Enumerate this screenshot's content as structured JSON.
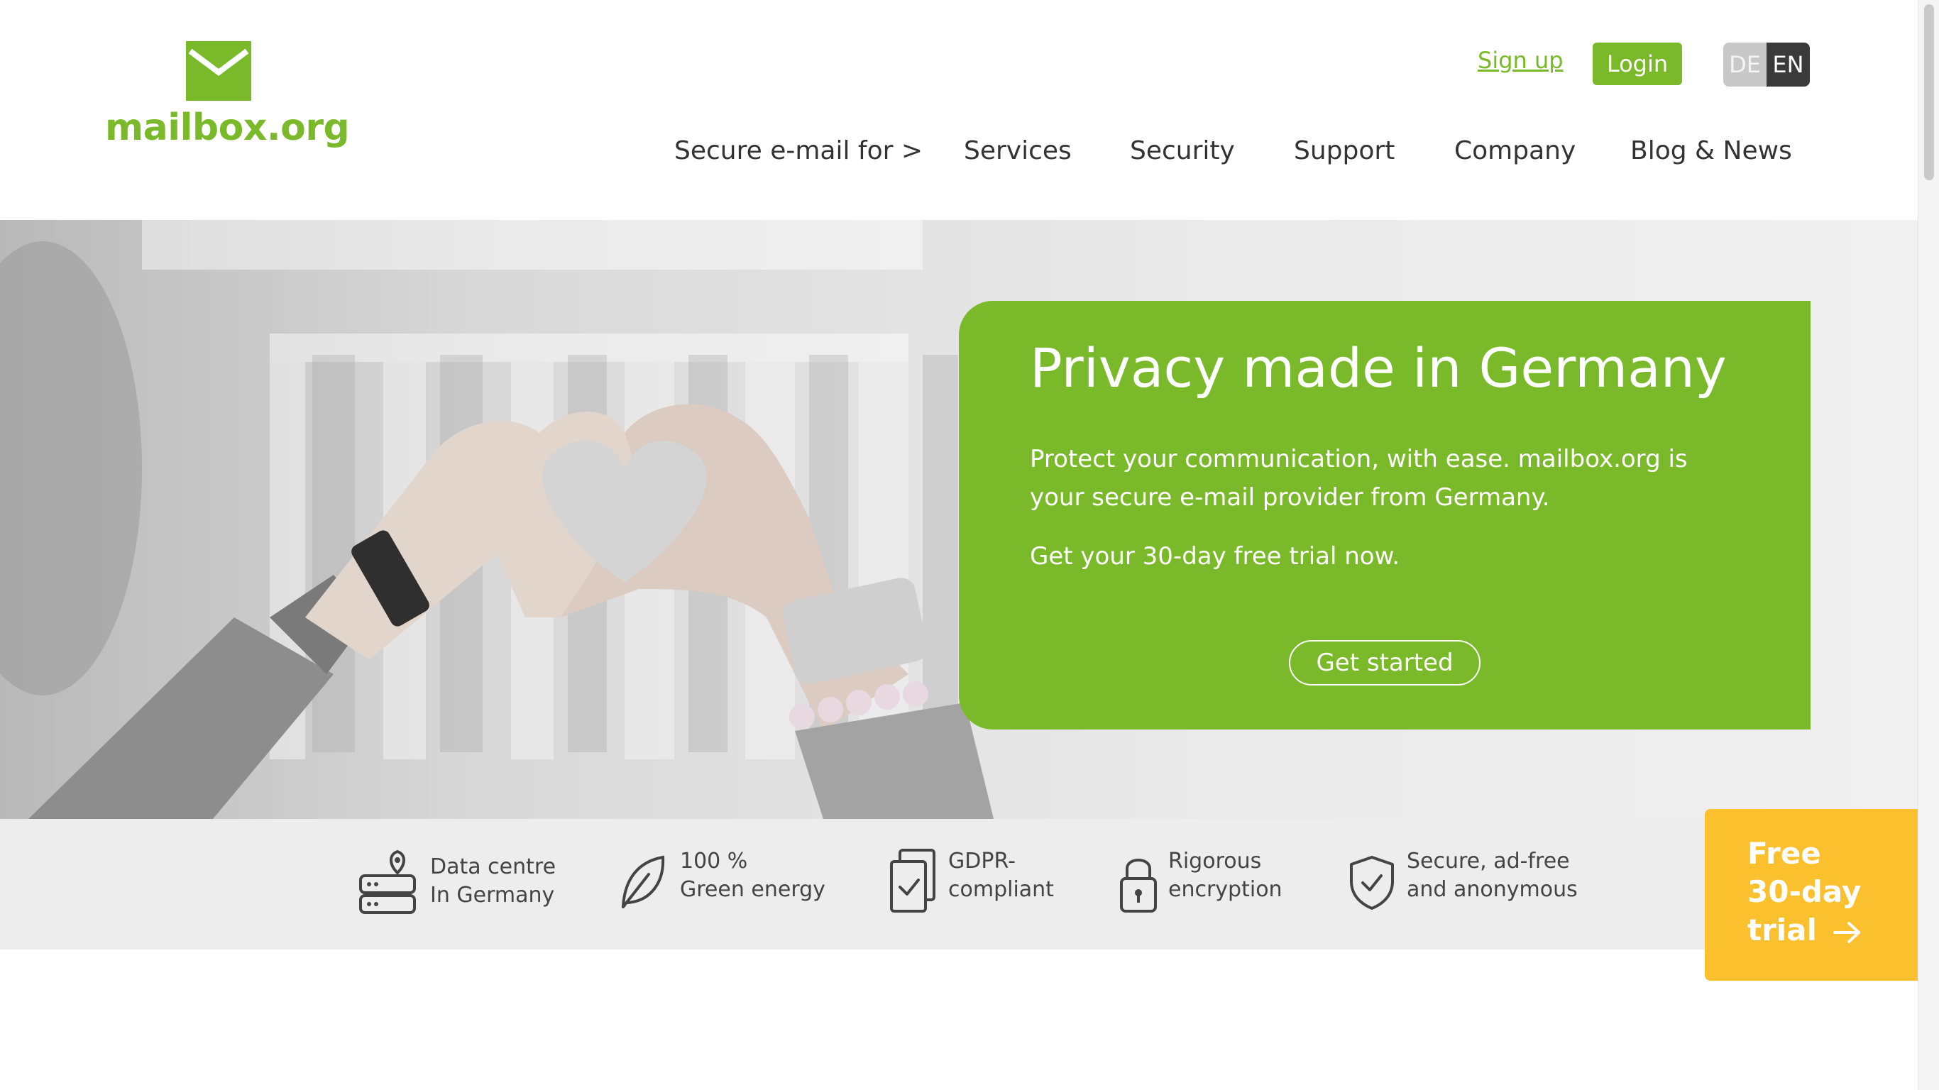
{
  "brand": {
    "logo_text": "mailbox.org",
    "logo_icon": "envelope-icon",
    "color": "#7ab929"
  },
  "header": {
    "signup_label": "Sign up",
    "login_label": "Login",
    "lang": {
      "de": "DE",
      "en": "EN",
      "active": "EN"
    },
    "nav": [
      {
        "label": "Secure e-mail for >"
      },
      {
        "label": "Services"
      },
      {
        "label": "Security"
      },
      {
        "label": "Support"
      },
      {
        "label": "Company"
      },
      {
        "label": "Blog & News"
      }
    ]
  },
  "hero": {
    "title": "Privacy made in Germany",
    "text": "Protect your communication, with ease. mailbox.org is your secure e-mail provider from Germany.",
    "cta_text": "Get your 30-day free trial now.",
    "button_label": "Get started",
    "card_color": "#7ab929"
  },
  "features": [
    {
      "icon": "server-location-icon",
      "line1": "Data centre",
      "line2": "In Germany"
    },
    {
      "icon": "leaf-icon",
      "line1": "100 %",
      "line2": "Green energy"
    },
    {
      "icon": "document-check-icon",
      "line1": "GDPR-",
      "line2": "compliant"
    },
    {
      "icon": "lock-icon",
      "line1": "Rigorous",
      "line2": "encryption"
    },
    {
      "icon": "shield-check-icon",
      "line1": "Secure, ad-free",
      "line2": "and anonymous"
    }
  ],
  "trial": {
    "line1": "Free",
    "line2": "30-day",
    "line3": "trial",
    "icon": "arrow-right-icon",
    "color": "#fbc02d"
  }
}
